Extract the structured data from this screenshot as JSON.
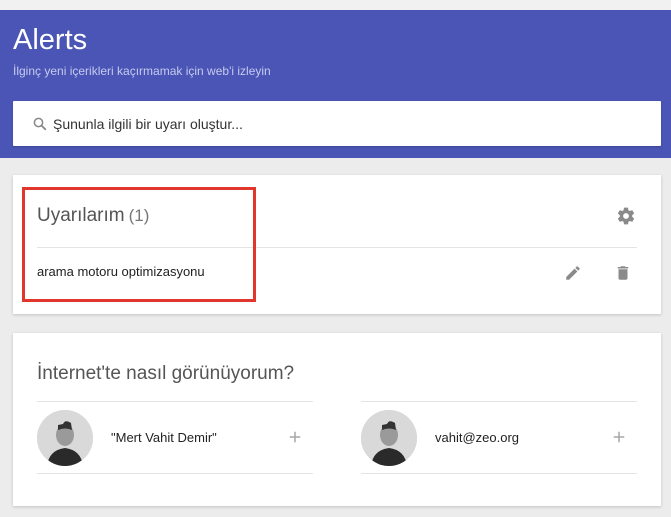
{
  "app": {
    "title": "Alerts",
    "subtitle": "İlginç yeni içerikleri kaçırmamak için web'i izleyin"
  },
  "search": {
    "placeholder": "Şununla ilgili bir uyarı oluştur..."
  },
  "my_alerts": {
    "title": "Uyarılarım",
    "count": "(1)",
    "items": [
      {
        "label": "arama motoru optimizasyonu"
      }
    ]
  },
  "me_on_web": {
    "title": "İnternet'te nasıl görünüyorum?",
    "identities": [
      {
        "label": "\"Mert Vahit Demir\""
      },
      {
        "label": "vahit@zeo.org"
      }
    ]
  },
  "colors": {
    "header": "#4a55b5",
    "highlight": "#e0362b",
    "icon": "#8a8a8a"
  },
  "icons": [
    "search-icon",
    "gear-icon",
    "pencil-icon",
    "trash-icon",
    "plus-icon"
  ]
}
